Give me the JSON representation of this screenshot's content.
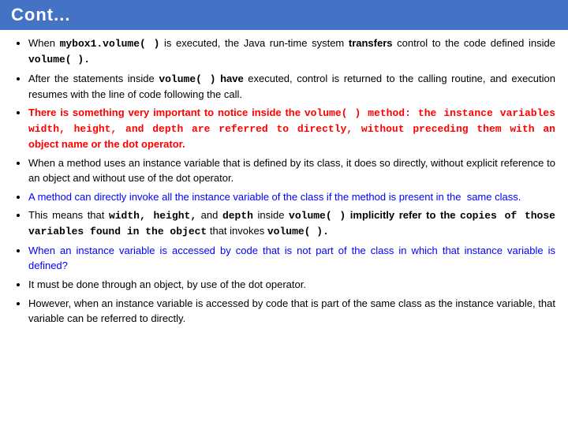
{
  "title": "Cont...",
  "bullets": [
    {
      "id": 1,
      "parts": [
        {
          "text": "When ",
          "style": "normal"
        },
        {
          "text": "mybox1.volume( )",
          "style": "bold-mono"
        },
        {
          "text": " is executed, the Java run-time system ",
          "style": "normal"
        },
        {
          "text": "transfers",
          "style": "bold"
        },
        {
          "text": " control to the code defined inside ",
          "style": "normal"
        },
        {
          "text": "volume( ).",
          "style": "bold-mono"
        }
      ]
    },
    {
      "id": 2,
      "parts": [
        {
          "text": "After the statements inside ",
          "style": "normal"
        },
        {
          "text": "volume( )",
          "style": "bold-mono"
        },
        {
          "text": " ",
          "style": "normal"
        },
        {
          "text": "have",
          "style": "bold"
        },
        {
          "text": " executed, control is returned to the calling routine, and execution resumes with the line of code following the call.",
          "style": "normal"
        }
      ]
    },
    {
      "id": 3,
      "parts": [
        {
          "text": "There is something very important to notice inside the ",
          "style": "red-normal"
        },
        {
          "text": "volume( ) method: the instance variables ",
          "style": "red-bold-mono-mix"
        },
        {
          "text": "width, height, and depth",
          "style": "red-bold-mono"
        },
        {
          "text": " are referred to directly, without preceding them with an",
          "style": "red-bold-normal"
        },
        {
          "text": " object name or the dot operator.",
          "style": "red-normal"
        }
      ]
    },
    {
      "id": 4,
      "parts": [
        {
          "text": "When a method uses an instance variable that is defined by its class, it does so directly, without explicit reference to an object and without use of the dot operator.",
          "style": "normal"
        }
      ]
    },
    {
      "id": 5,
      "parts": [
        {
          "text": "A method can directly invoke all the instance variable of the class if the method is present in the  same class.",
          "style": "blue"
        }
      ]
    },
    {
      "id": 6,
      "parts": [
        {
          "text": "This means that ",
          "style": "normal"
        },
        {
          "text": "width, height,",
          "style": "bold-mono"
        },
        {
          "text": " and ",
          "style": "normal"
        },
        {
          "text": "depth",
          "style": "bold-mono"
        },
        {
          "text": " inside ",
          "style": "normal"
        },
        {
          "text": "volume( )",
          "style": "bold-mono"
        },
        {
          "text": " implicitly ",
          "style": "bold"
        },
        {
          "text": "refer to the ",
          "style": "bold"
        },
        {
          "text": "copies of those variables found in the object",
          "style": "bold-mono"
        },
        {
          "text": " that invokes ",
          "style": "normal"
        },
        {
          "text": "volume( ).",
          "style": "bold-mono"
        }
      ]
    },
    {
      "id": 7,
      "parts": [
        {
          "text": "When an instance variable is accessed by code that is not part of the class in which that instance variable is defined?",
          "style": "blue"
        }
      ]
    },
    {
      "id": 8,
      "parts": [
        {
          "text": "It must be done through an object, by use of the dot operator.",
          "style": "normal"
        }
      ]
    },
    {
      "id": 9,
      "parts": [
        {
          "text": "However, when an instance variable is accessed by code that is part of the same class as the instance variable, that variable can be referred to directly.",
          "style": "normal"
        }
      ]
    }
  ]
}
